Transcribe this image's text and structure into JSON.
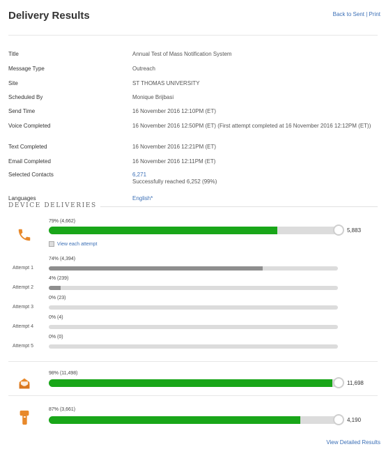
{
  "header": {
    "title": "Delivery Results",
    "back_link": "Back to Sent",
    "separator": "|",
    "print_link": "Print"
  },
  "details": [
    {
      "label": "Title",
      "value": "Annual Test of Mass Notification System"
    },
    {
      "label": "Message Type",
      "value": "Outreach"
    },
    {
      "label": "Site",
      "value": "ST THOMAS UNIVERSITY"
    },
    {
      "label": "Scheduled By",
      "value": "Monique Brijbasi"
    },
    {
      "label": "Send Time",
      "value": "16 November 2016 12:10PM (ET)"
    },
    {
      "label": "Voice Completed",
      "value": "16 November 2016 12:50PM (ET) (First attempt completed at 16 November 2016 12:12PM (ET))"
    },
    {
      "label": "Text Completed",
      "value": "16 November 2016 12:21PM (ET)"
    },
    {
      "label": "Email Completed",
      "value": "16 November 2016 12:11PM (ET)"
    },
    {
      "label": "Selected Contacts",
      "value": "6,271",
      "sub": "Successfully reached 6,252 (99%)"
    },
    {
      "label": "Languages",
      "value": "English*"
    }
  ],
  "device_deliveries": {
    "section_title": "DEVICE DELIVERIES",
    "voice": {
      "icon": "phone-icon",
      "pct_text": "79% (4,662)",
      "fraction": 0.79,
      "total": "5,883",
      "view_attempts_label": "View each attempt",
      "attempts": [
        {
          "label": "Attempt 1",
          "pct_text": "74% (4,394)",
          "fraction": 0.74
        },
        {
          "label": "Attempt 2",
          "pct_text": "4% (239)",
          "fraction": 0.04
        },
        {
          "label": "Attempt 3",
          "pct_text": "0% (23)",
          "fraction": 0.0
        },
        {
          "label": "Attempt 4",
          "pct_text": "0% (4)",
          "fraction": 0.0
        },
        {
          "label": "Attempt 5",
          "pct_text": "0% (0)",
          "fraction": 0.0
        }
      ]
    },
    "email": {
      "icon": "email-icon",
      "pct_text": "98% (11,498)",
      "fraction": 0.98,
      "total": "11,698"
    },
    "text": {
      "icon": "mobile-phone-icon",
      "pct_text": "87% (3,661)",
      "fraction": 0.87,
      "total": "4,190"
    }
  },
  "footer": {
    "detailed_link": "View Detailed Results"
  },
  "colors": {
    "accent_orange": "#e8892b",
    "bar_green": "#19a619",
    "attempt_gray": "#8e8e8e",
    "link_blue": "#3b6fb6"
  }
}
